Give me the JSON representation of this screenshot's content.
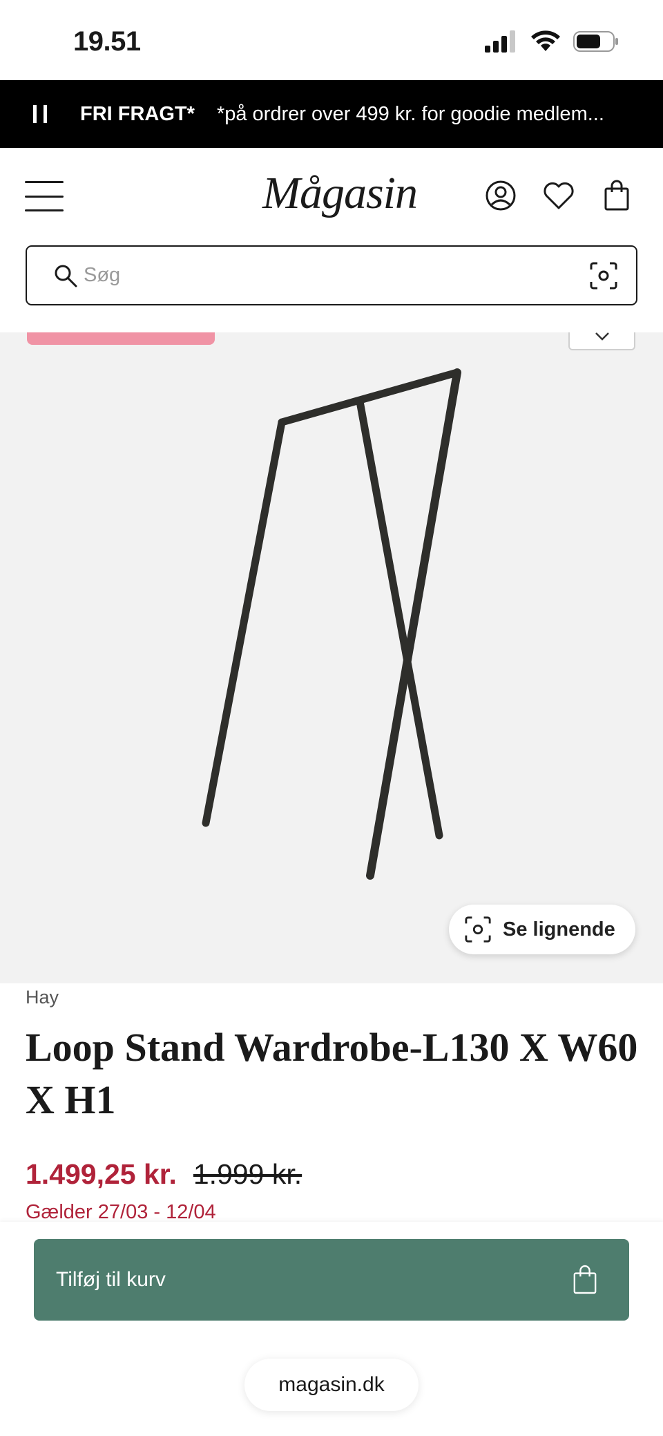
{
  "status_bar": {
    "time": "19.51"
  },
  "promo": {
    "title": "FRI FRAGT*",
    "text": "*på ordrer over 499 kr. for goodie medlem..."
  },
  "header": {
    "logo": "Mågasin"
  },
  "search": {
    "placeholder": "Søg"
  },
  "product": {
    "similar_label": "Se lignende",
    "brand": "Hay",
    "title": "Loop Stand Wardrobe-L130 X W60 X H1",
    "price_current": "1.499,25 kr.",
    "price_original": "1.999 kr.",
    "valid_period": "Gælder 27/03 - 12/04",
    "badge_color": "#f093a5"
  },
  "cart": {
    "add_label": "Tilføj til kurv",
    "button_color": "#4e7d6e"
  },
  "browser": {
    "url": "magasin.dk"
  }
}
